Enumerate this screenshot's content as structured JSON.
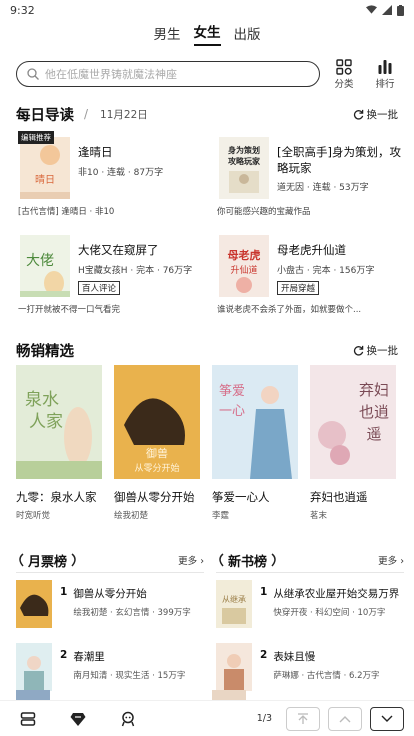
{
  "status": {
    "time": "9:32"
  },
  "tabs": [
    {
      "label": "男生",
      "active": false
    },
    {
      "label": "女生",
      "active": true
    },
    {
      "label": "出版",
      "active": false
    }
  ],
  "search": {
    "placeholder": "他在低魔世界铸就魔法神座"
  },
  "tools": {
    "category": "分类",
    "ranking": "排行"
  },
  "daily": {
    "title": "每日导读",
    "date": "11月22日",
    "refresh": "换一批",
    "items": [
      {
        "badge": "编辑推荐",
        "title": "逢晴日",
        "meta": "非10 · 连载 · 87万字",
        "tag": "",
        "desc": "[古代言情] 逢晴日 · 非10",
        "cover_colors": [
          "#f6e6d4",
          "#d9683c"
        ],
        "cover_text": "逢晴日"
      },
      {
        "badge": "",
        "title": "[全职高手]身为策划，攻略玩家",
        "meta": "道无因 · 连载 · 53万字",
        "tag": "",
        "desc": "你可能感兴趣的宝藏作品",
        "cover_colors": [
          "#f3f0e7",
          "#2a2a2a"
        ],
        "cover_text": "身为策划攻略玩家"
      },
      {
        "badge": "",
        "title": "大佬又在窥屏了",
        "meta": "H宝藏女孩H · 完本 · 76万字",
        "tag": "百人评论",
        "desc": "一打开就被不得一口气看完",
        "cover_colors": [
          "#eef3e6",
          "#4d8a3c"
        ],
        "cover_text": "大佬又在窥屏了"
      },
      {
        "badge": "",
        "title": "母老虎升仙道",
        "meta": "小盘古 · 完本 · 156万字",
        "tag": "开局穿越",
        "desc": "谁说老虎不会杀了外面，如就要做个...",
        "cover_colors": [
          "#f5e9e2",
          "#c9352d"
        ],
        "cover_text": "母老虎升仙道"
      }
    ]
  },
  "bestseller": {
    "title": "畅销精选",
    "refresh": "换一批",
    "items": [
      {
        "title": "九零：泉水人家",
        "author": "时宽听觉",
        "cover_colors": [
          "#e3ecd8",
          "#7fa25a"
        ],
        "cover_text": "泉水人家"
      },
      {
        "title": "御兽从零分开始",
        "author": "绘我初楚",
        "cover_colors": [
          "#e9b24d",
          "#3b2a1a"
        ],
        "cover_text": "御兽从零分开始"
      },
      {
        "title": "筝爱一心人",
        "author": "李霆",
        "cover_colors": [
          "#dbeaf3",
          "#7aa7c8"
        ],
        "cover_text": "筝爱一心人"
      },
      {
        "title": "弃妇也逍遥",
        "author": "茗末",
        "cover_colors": [
          "#f3e6e8",
          "#b97a86"
        ],
        "cover_text": "弃妇也逍遥"
      }
    ]
  },
  "rank_monthly": {
    "title": "月票榜",
    "more": "更多",
    "items": [
      {
        "num": "1",
        "title": "御兽从零分开始",
        "meta": "绘我初楚 · 玄幻言情 · 399万字",
        "cover_colors": [
          "#e9b24d",
          "#3b2a1a"
        ]
      },
      {
        "num": "2",
        "title": "春潮里",
        "meta": "南月知清 · 现实生活 · 15万字",
        "cover_colors": [
          "#dfeef0",
          "#8fb6b8"
        ]
      }
    ]
  },
  "rank_new": {
    "title": "新书榜",
    "more": "更多",
    "items": [
      {
        "num": "1",
        "title": "从继承农业屋开始交易万界",
        "meta": "快穿开夜 · 科幻空间 · 10万字",
        "cover_colors": [
          "#f2ecd9",
          "#9a7d46"
        ]
      },
      {
        "num": "2",
        "title": "表妹且慢",
        "meta": "萨琳娜 · 古代言情 · 6.2万字",
        "cover_colors": [
          "#f5e7dc",
          "#c98b6a"
        ]
      }
    ]
  },
  "pager": {
    "page": "1/3"
  },
  "colors": {
    "accent": "#111111",
    "muted": "#555555"
  }
}
